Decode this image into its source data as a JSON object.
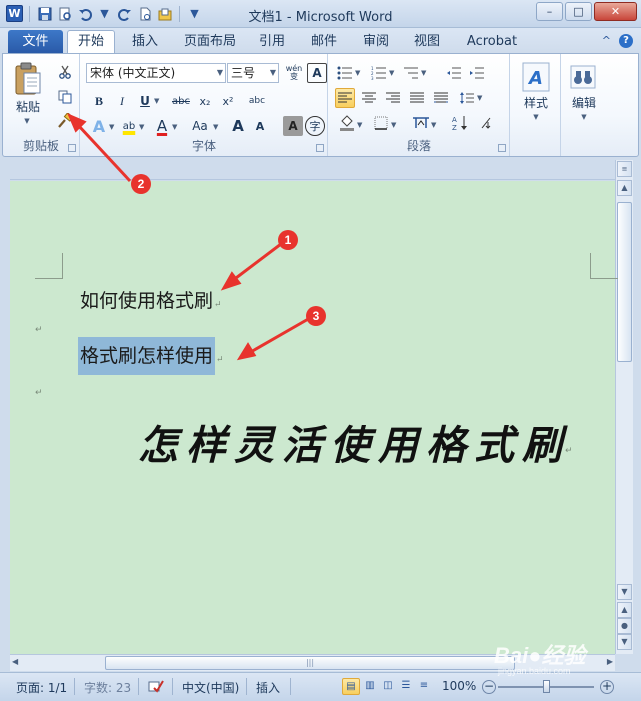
{
  "window": {
    "title": "文档1 - Microsoft Word",
    "minimize": "–",
    "maximize": "□",
    "close": "✕",
    "logo_letter": "W"
  },
  "qat": {
    "save_icon": "save-icon",
    "undo_icon": "undo-icon",
    "redo_icon": "redo-icon"
  },
  "tabs": {
    "file": "文件",
    "items": [
      "开始",
      "插入",
      "页面布局",
      "引用",
      "邮件",
      "审阅",
      "视图",
      "Acrobat"
    ],
    "active_index": 0
  },
  "ribbon": {
    "clipboard": {
      "label": "剪贴板",
      "paste_label": "粘贴"
    },
    "font": {
      "label": "字体",
      "font_name": "宋体 (中文正文)",
      "font_size": "三号",
      "wen_label": "wén\n变",
      "a_box": "A",
      "bold": "B",
      "italic": "I",
      "underline": "U",
      "strike": "abc",
      "subscript": "x₂",
      "superscript": "x²",
      "grow": "A",
      "shrink": "A",
      "case": "Aa",
      "char_shade": "A",
      "enclose": "字",
      "phonetic": "abc",
      "highlight": "ab",
      "font_color": "A",
      "text_effect": "A",
      "highlight_color": "#ffe600",
      "font_color_value": "#e02020"
    },
    "paragraph": {
      "label": "段落"
    },
    "styles": {
      "label": "样式"
    },
    "editing": {
      "label": "编辑"
    }
  },
  "document": {
    "line1": "如何使用格式刷",
    "line2": "格式刷怎样使用",
    "title": "怎样灵活使用格式刷",
    "para_mark": "↵"
  },
  "statusbar": {
    "page": "页面: 1/1",
    "words": "字数: 23",
    "language": "中文(中国)",
    "mode": "插入",
    "zoom": "100%",
    "zoom_minus": "−",
    "zoom_plus": "+"
  },
  "annotations": {
    "callout1": "1",
    "callout2": "2",
    "callout3": "3",
    "color": "#e8332d"
  },
  "watermark": {
    "brand": "Bai●经验",
    "url": "jingyan.baidu.com"
  }
}
